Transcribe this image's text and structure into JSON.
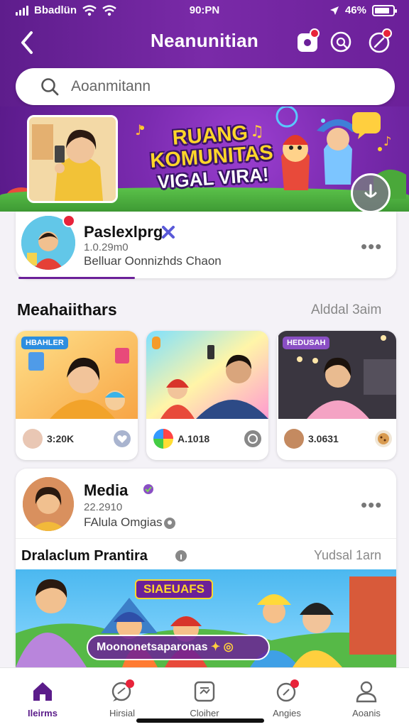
{
  "status": {
    "carrier": "Bbadlün",
    "time": "90:PN",
    "battery": "46%"
  },
  "header": {
    "title": "Neanunitian",
    "back_icon": "chevron-left-icon",
    "notif_badge_1": "",
    "notif_badge_2": ""
  },
  "search": {
    "placeholder": "Aoanmitann"
  },
  "banner": {
    "line1": "RUANG",
    "line2": "KOMUNITAS",
    "line3": "VIGAL VIRA!",
    "photo_caption": ""
  },
  "post1": {
    "name": "Paslexlprg",
    "meta": "1.0.29m0",
    "sub": "Belluar Oonnizhds Chaon",
    "more": "•••"
  },
  "section": {
    "title": "Meahaiithars",
    "link": "Alddal 3aim"
  },
  "videos": [
    {
      "tag": "HBAHLER",
      "stat": "3:20K"
    },
    {
      "tag": "",
      "stat": "A.1018"
    },
    {
      "tag": "HEDUSAH",
      "stat": "3.0631"
    }
  ],
  "post2": {
    "name": "Media",
    "meta": "22.2910",
    "sub": "FAlula Omgias",
    "more": "•••"
  },
  "feature": {
    "title": "Dralaclum Prantira",
    "link": "Yudsal 1arn",
    "badge": "SIAEUAFS",
    "caption": "Moononetsaparonas"
  },
  "nav": [
    {
      "label": "Ileirms",
      "icon": "home-icon"
    },
    {
      "label": "Hirsial",
      "icon": "chat-icon"
    },
    {
      "label": "Cloiher",
      "icon": "media-icon"
    },
    {
      "label": "Angies",
      "icon": "bell-icon"
    },
    {
      "label": "Aoanis",
      "icon": "profile-icon"
    }
  ],
  "colors": {
    "brand": "#6b2099",
    "accent": "#ffd62a",
    "badge": "#e8233a"
  }
}
